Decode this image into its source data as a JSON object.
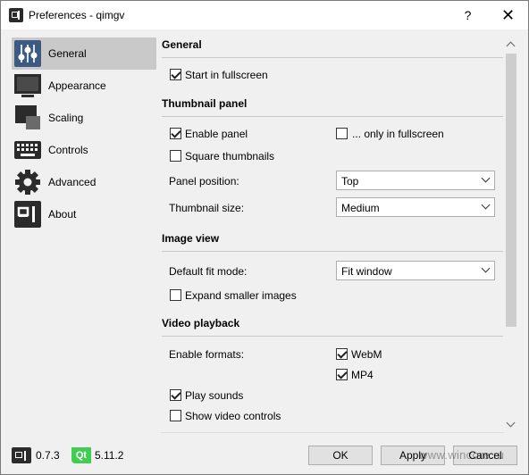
{
  "window": {
    "title": "Preferences - qimgv",
    "help_label": "?",
    "close_label": "✕"
  },
  "sidebar": {
    "items": [
      {
        "label": "General",
        "icon": "sliders-icon"
      },
      {
        "label": "Appearance",
        "icon": "monitor-icon"
      },
      {
        "label": "Scaling",
        "icon": "scaling-icon"
      },
      {
        "label": "Controls",
        "icon": "keyboard-icon"
      },
      {
        "label": "Advanced",
        "icon": "gear-icon"
      },
      {
        "label": "About",
        "icon": "qimgv-logo-icon"
      }
    ],
    "active": "General"
  },
  "general": {
    "title": "General",
    "start_fullscreen": {
      "label": "Start in fullscreen",
      "checked": true
    }
  },
  "thumbnail_panel": {
    "title": "Thumbnail panel",
    "enable_panel": {
      "label": "Enable panel",
      "checked": true
    },
    "only_fullscreen": {
      "label": "... only in fullscreen",
      "checked": false
    },
    "square_thumbnails": {
      "label": "Square thumbnails",
      "checked": false
    },
    "panel_position": {
      "label": "Panel position:",
      "value": "Top"
    },
    "thumbnail_size": {
      "label": "Thumbnail size:",
      "value": "Medium"
    }
  },
  "image_view": {
    "title": "Image view",
    "fit_mode": {
      "label": "Default fit mode:",
      "value": "Fit window"
    },
    "expand_smaller": {
      "label": "Expand smaller images",
      "checked": false
    }
  },
  "video_playback": {
    "title": "Video playback",
    "enable_formats_label": "Enable formats:",
    "webm": {
      "label": "WebM",
      "checked": true
    },
    "mp4": {
      "label": "MP4",
      "checked": true
    },
    "play_sounds": {
      "label": "Play sounds",
      "checked": true
    },
    "show_controls": {
      "label": "Show video controls",
      "checked": false
    }
  },
  "footer": {
    "app_version": "0.7.3",
    "qt_label": "Qt",
    "qt_version": "5.11.2",
    "ok_label": "OK",
    "apply_label": "Apply",
    "cancel_label": "Cancel",
    "watermark": "www.wincore.ru"
  }
}
